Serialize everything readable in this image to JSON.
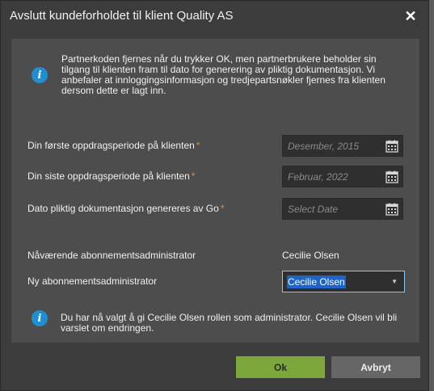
{
  "dialog": {
    "title": "Avslutt kundeforholdet til klient Quality AS",
    "close_glyph": "✕"
  },
  "info_top": {
    "icon": "info-icon",
    "text": "Partnerkoden fjernes når du trykker OK, men partnerbrukere beholder sin tilgang til klienten fram til dato for generering av pliktig dokumentasjon. Vi anbefaler at innloggingsinformasjon og tredjepartsnøkler fjernes fra klienten dersom dette er lagt inn."
  },
  "fields": {
    "first_period": {
      "label": "Din første oppdragsperiode på klienten",
      "required": "*",
      "value": "Desember, 2015"
    },
    "last_period": {
      "label": "Din siste oppdragsperiode på klienten",
      "required": "*",
      "value": "Februar, 2022"
    },
    "doc_date": {
      "label": "Dato pliktig dokumentasjon genereres av Go",
      "required": "*",
      "placeholder": "Select Date"
    }
  },
  "admin": {
    "current_label": "Nåværende abonnementsadministrator",
    "current_value": "Cecilie Olsen",
    "new_label": "Ny abonnementsadministrator",
    "new_value": "Cecilie Olsen"
  },
  "info_bottom": {
    "icon": "info-icon",
    "text": "Du har nå valgt å gi Cecilie Olsen rollen som administrator. Cecilie Olsen vil bli varslet om endringen."
  },
  "buttons": {
    "ok": "Ok",
    "cancel": "Avbryt"
  },
  "colors": {
    "ok_button": "#7ca73a",
    "info_icon": "#1f8fd1",
    "required_marker": "#e0902e",
    "selection": "#1e64c8"
  }
}
